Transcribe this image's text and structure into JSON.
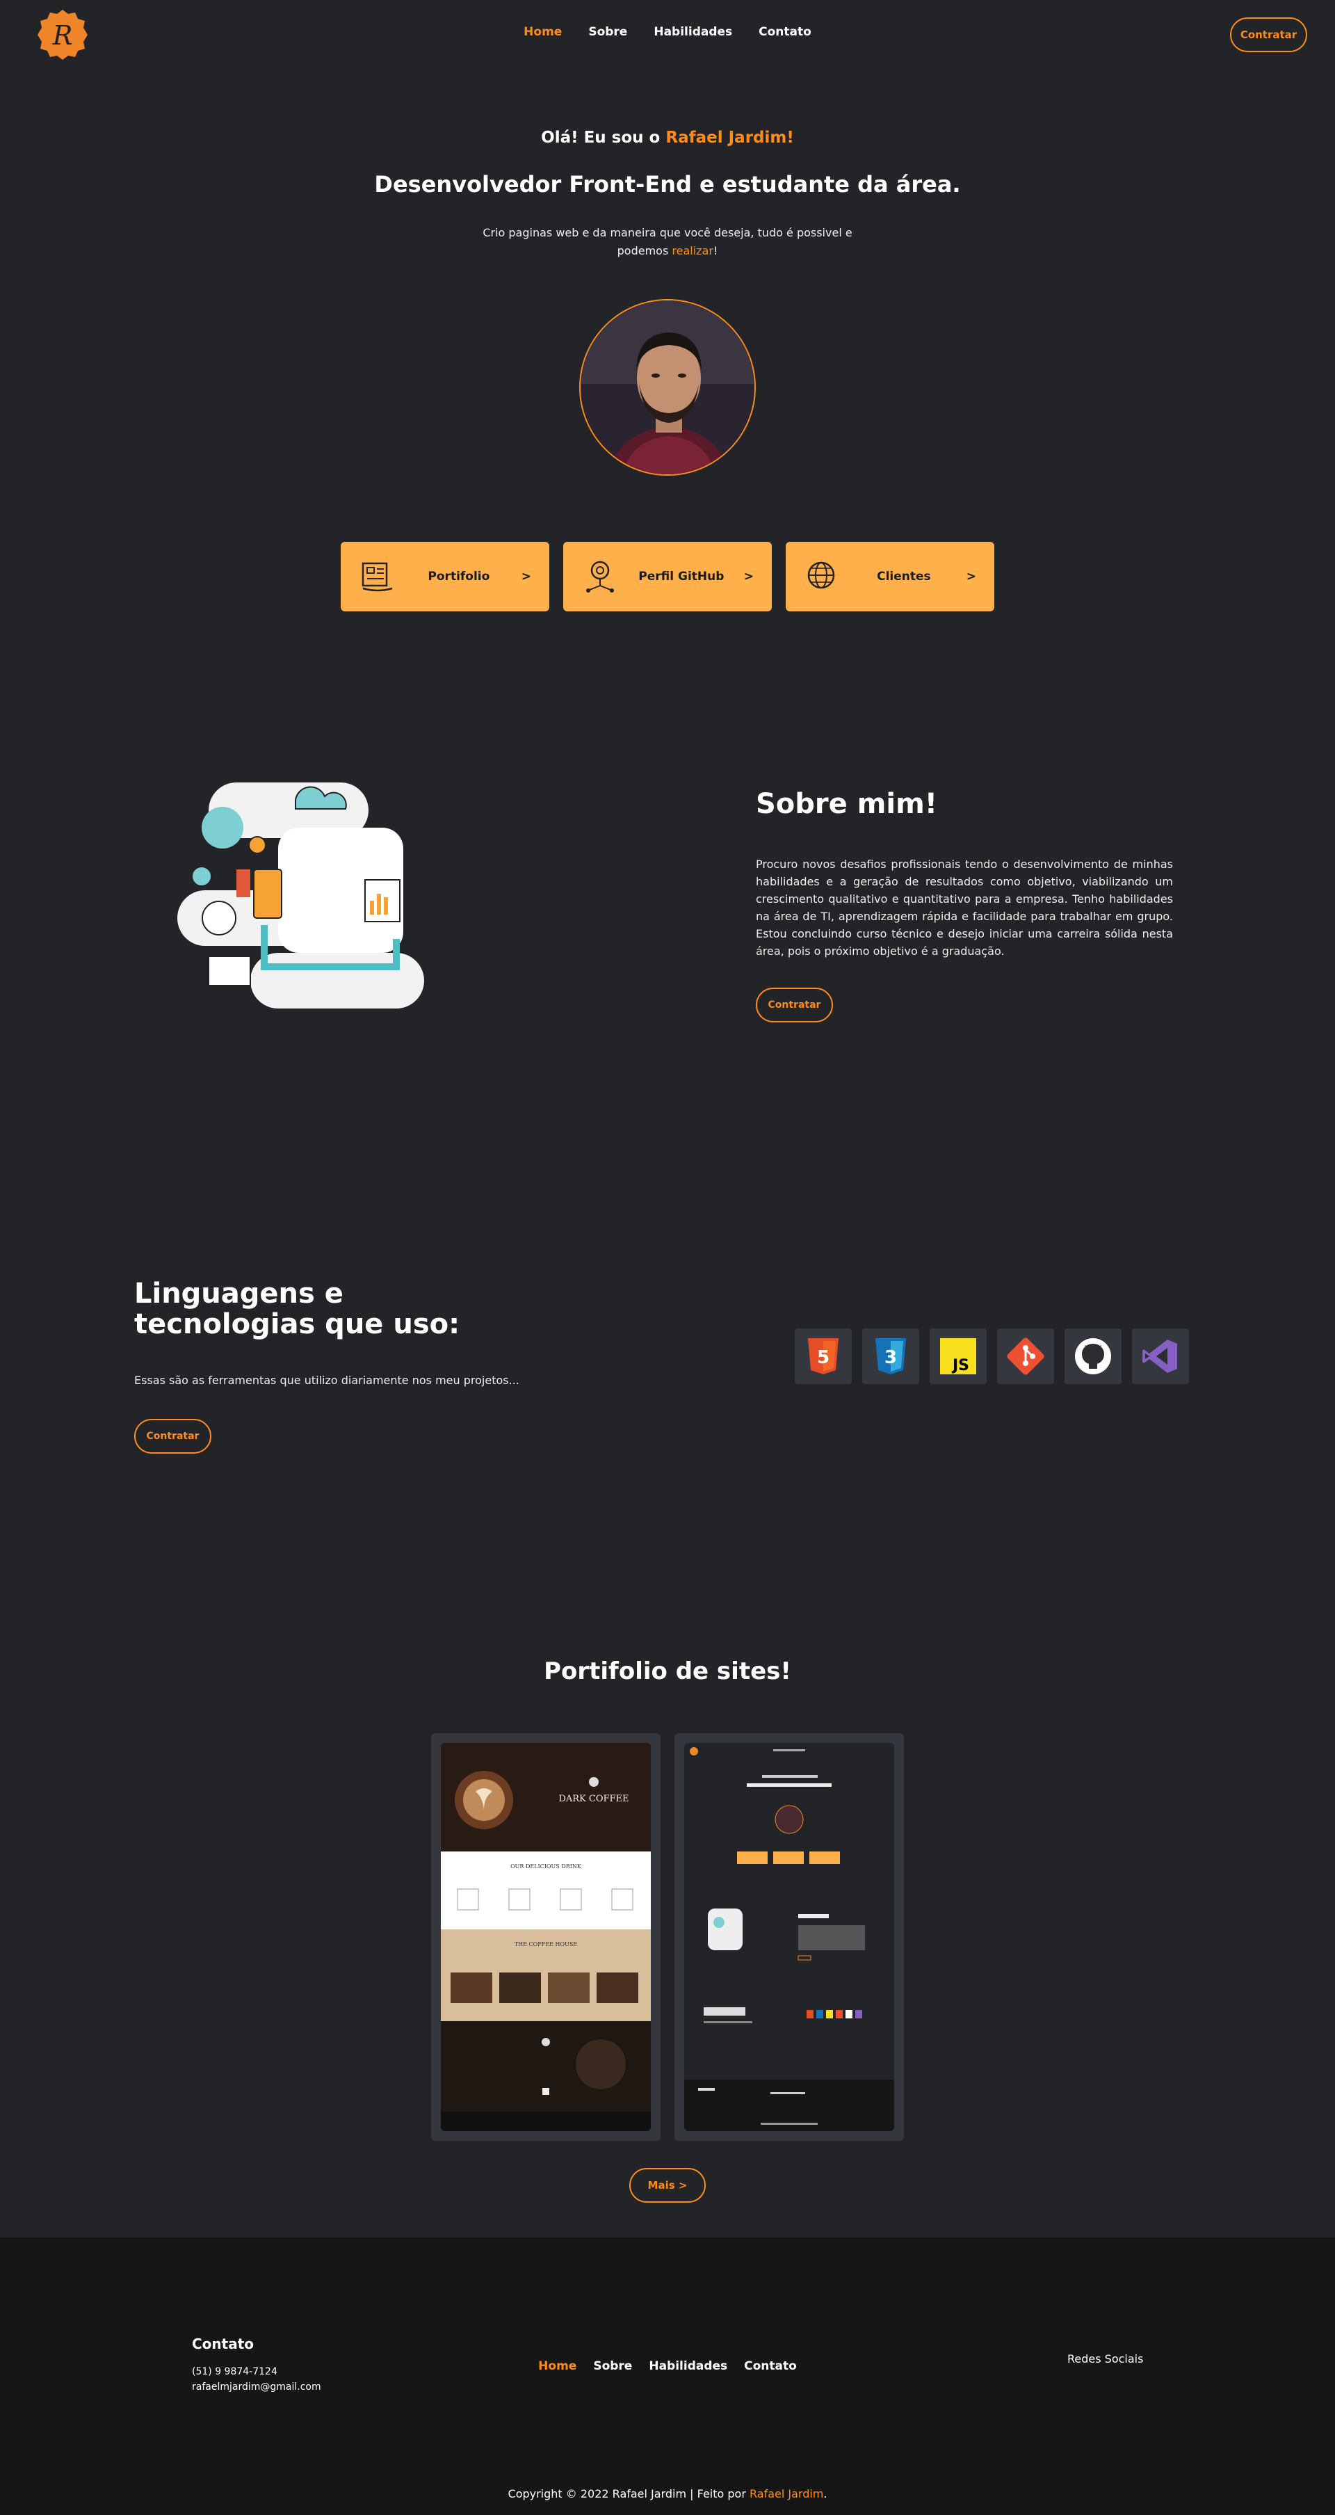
{
  "header": {
    "logo_letter": "R",
    "nav": [
      {
        "label": "Home",
        "active": true
      },
      {
        "label": "Sobre",
        "active": false
      },
      {
        "label": "Habilidades",
        "active": false
      },
      {
        "label": "Contato",
        "active": false
      }
    ],
    "cta_label": "Contratar"
  },
  "hero": {
    "greeting_prefix": "Olá! Eu sou o ",
    "greeting_name": "Rafael Jardim!",
    "title": "Desenvolvedor Front-End e estudante da área.",
    "desc_line1": "Crio paginas web e da maneira que você deseja, tudo é possivel e",
    "desc_line2_prefix": "podemos ",
    "desc_highlight": "realizar",
    "desc_suffix": "!"
  },
  "cards": [
    {
      "icon": "portfolio-icon",
      "label": "Portifolio",
      "arrow": ">"
    },
    {
      "icon": "github-network-icon",
      "label": "Perfil GitHub",
      "arrow": ">"
    },
    {
      "icon": "globe-icon",
      "label": "Clientes",
      "arrow": ">"
    }
  ],
  "about": {
    "title": "Sobre mim!",
    "text": "Procuro novos desafios profissionais tendo o desenvolvimento de minhas habilidades e a geração de resultados como objetivo, viabilizando um crescimento qualitativo e quantitativo para a empresa. Tenho habilidades na área de TI, aprendizagem rápida e facilidade para trabalhar em grupo. Estou concluindo curso técnico e desejo iniciar uma carreira sólida nesta área, pois o próximo objetivo é a graduação.",
    "button": "Contratar"
  },
  "langs": {
    "title_line1": "Linguagens e",
    "title_line2": "tecnologias que uso:",
    "desc": "Essas são as ferramentas que utilizo diariamente nos meu projetos...",
    "button": "Contratar",
    "techs": [
      {
        "icon": "html5-icon",
        "text": "5",
        "color": "#e44d26"
      },
      {
        "icon": "css3-icon",
        "text": "3",
        "color": "#1572b6"
      },
      {
        "icon": "javascript-icon",
        "text": "JS",
        "color": "#f7df1e"
      },
      {
        "icon": "git-icon",
        "text": "",
        "color": "#f05032"
      },
      {
        "icon": "github-icon",
        "text": "",
        "color": "#ffffff"
      },
      {
        "icon": "visual-studio-icon",
        "text": "",
        "color": "#865fc5"
      }
    ]
  },
  "portfolio": {
    "title": "Portifolio de sites!",
    "thumb1_title": "DARK COFFEE",
    "thumb1_section1": "OUR DELICIOUS DRINK",
    "thumb1_section2": "THE COFFEE HOUSE",
    "more": "Mais >"
  },
  "footer": {
    "contact_title": "Contato",
    "phone": "(51) 9 9874-7124",
    "email": "rafaelmjardim@gmail.com",
    "nav": [
      {
        "label": "Home",
        "active": true
      },
      {
        "label": "Sobre",
        "active": false
      },
      {
        "label": "Habilidades",
        "active": false
      },
      {
        "label": "Contato",
        "active": false
      }
    ],
    "social": "Redes Sociais",
    "copy_prefix": "Copyright © 2022 Rafael Jardim | Feito por ",
    "copy_name": "Rafael Jardim",
    "copy_suffix": "."
  }
}
